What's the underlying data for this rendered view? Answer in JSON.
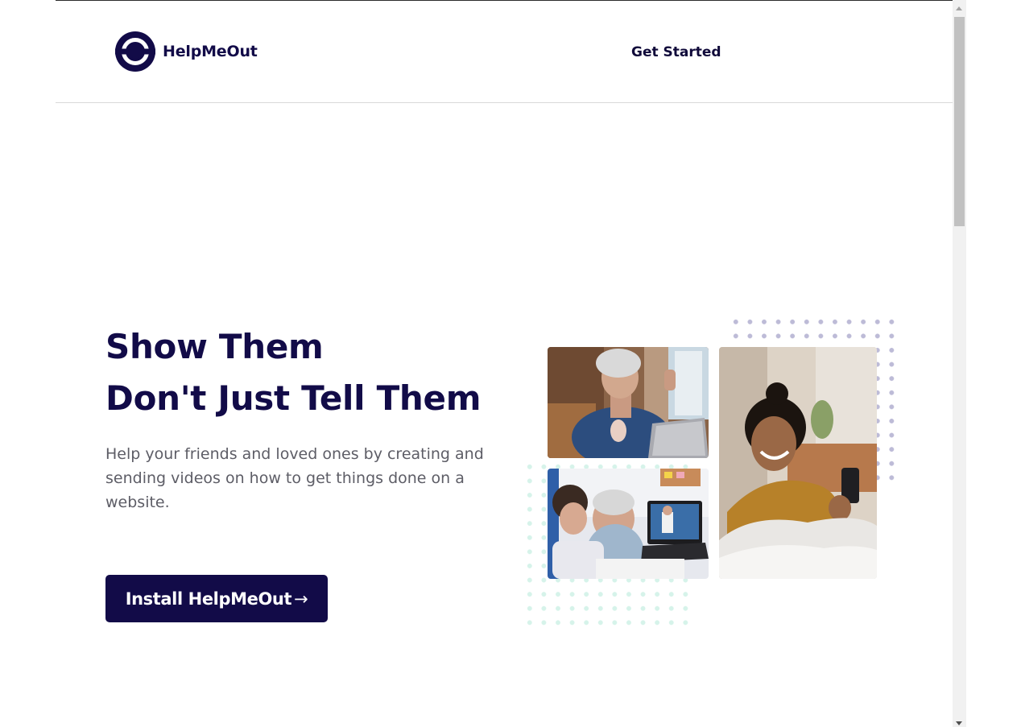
{
  "header": {
    "logo_text": "HelpMeOut",
    "nav_link": "Get Started"
  },
  "hero": {
    "title_line1": "Show Them",
    "title_line2": "Don't Just Tell Them",
    "description": "Help your friends and loved ones by creating and sending videos on how to get things done on a website.",
    "cta_label": "Install HelpMeOut",
    "cta_arrow": "→"
  },
  "colors": {
    "brand_navy": "#120b48",
    "body_text": "#5d5d66",
    "dots_purple": "#bdbbd7",
    "dots_mint": "#d6f3ea"
  },
  "icons": {
    "logo": "helpmeout-logo-icon",
    "cta_arrow": "arrow-right-icon"
  }
}
